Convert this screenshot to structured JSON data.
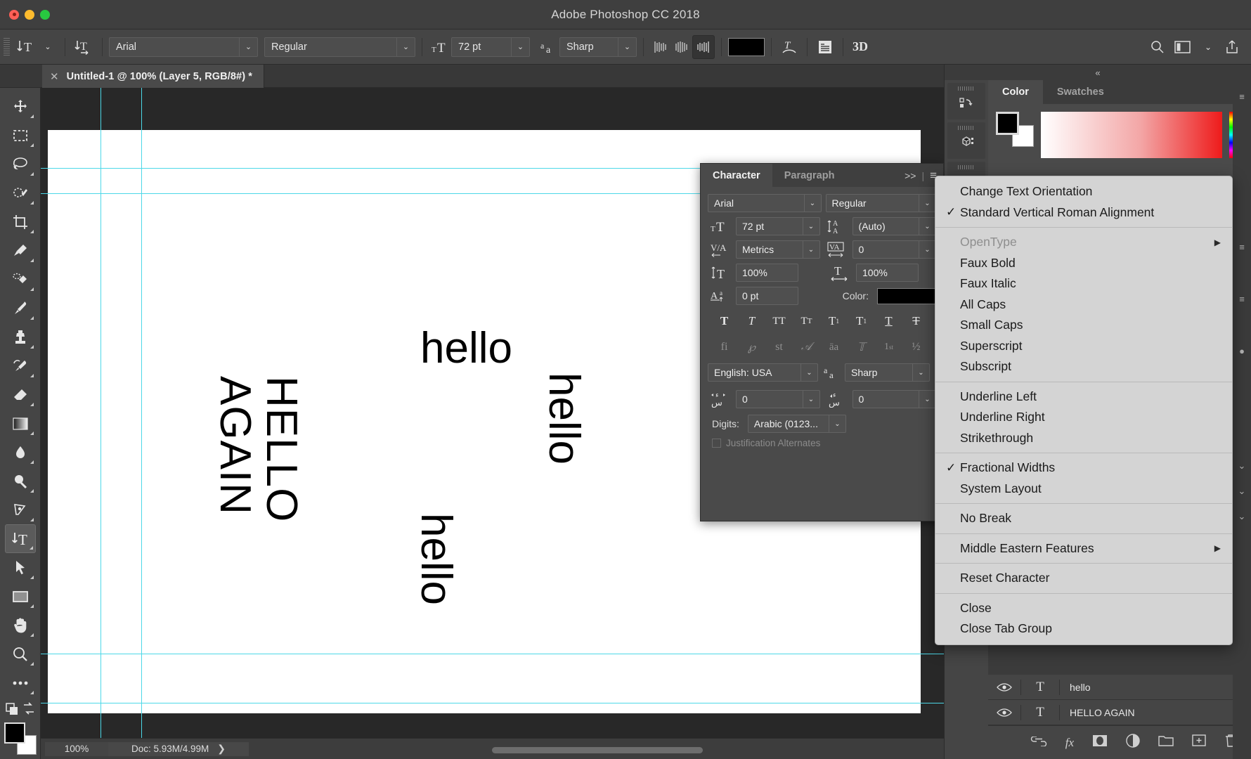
{
  "window": {
    "title": "Adobe Photoshop CC 2018"
  },
  "options_bar": {
    "tool_preset_icon": "vertical-type-tool-icon",
    "orientation_icon": "toggle-text-orientation-icon",
    "font_family": "Arial",
    "font_style": "Regular",
    "font_size": "72 pt",
    "antialias_icon": "anti-aliasing-icon",
    "antialias": "Sharp",
    "align_left_icon": "align-text-left-icon",
    "align_center_icon": "align-text-center-icon",
    "align_right_icon": "align-text-right-icon",
    "color_label": "text-color-swatch",
    "color_hex": "#000000",
    "warp_icon": "create-warped-text-icon",
    "panels_icon": "toggle-character-paragraph-panels-icon",
    "three_d_icon": "3D",
    "search_icon": "search-icon",
    "workspace_icon": "workspace-switcher-icon",
    "share_icon": "share-icon"
  },
  "document": {
    "tab_title": "Untitled-1 @ 100% (Layer 5, RGB/8#) *",
    "close_icon": "close-tab-icon"
  },
  "toolbar": {
    "tools": [
      {
        "name": "move-tool",
        "active": false
      },
      {
        "name": "rectangular-marquee-tool",
        "active": false
      },
      {
        "name": "lasso-tool",
        "active": false
      },
      {
        "name": "quick-selection-tool",
        "active": false
      },
      {
        "name": "crop-tool",
        "active": false
      },
      {
        "name": "eyedropper-tool",
        "active": false
      },
      {
        "name": "spot-healing-brush-tool",
        "active": false
      },
      {
        "name": "brush-tool",
        "active": false
      },
      {
        "name": "clone-stamp-tool",
        "active": false
      },
      {
        "name": "history-brush-tool",
        "active": false
      },
      {
        "name": "eraser-tool",
        "active": false
      },
      {
        "name": "gradient-tool",
        "active": false
      },
      {
        "name": "blur-tool",
        "active": false
      },
      {
        "name": "dodge-tool",
        "active": false
      },
      {
        "name": "pen-tool",
        "active": false
      },
      {
        "name": "vertical-type-tool",
        "active": true
      },
      {
        "name": "path-selection-tool",
        "active": false
      },
      {
        "name": "rectangle-tool",
        "active": false
      },
      {
        "name": "hand-tool",
        "active": false
      },
      {
        "name": "zoom-tool",
        "active": false
      },
      {
        "name": "edit-toolbar-tool",
        "active": false
      }
    ],
    "foreground_color": "#000000",
    "background_color": "#ffffff"
  },
  "canvas": {
    "texts": [
      {
        "content": "hello",
        "orientation": "horizontal"
      },
      {
        "content": "HELLO",
        "orientation": "vertical"
      },
      {
        "content": "AGAIN",
        "orientation": "vertical"
      },
      {
        "content": "hello",
        "orientation": "vertical"
      },
      {
        "content": "hello",
        "orientation": "vertical"
      }
    ],
    "guide_color": "#4cd8e8"
  },
  "status_bar": {
    "zoom": "100%",
    "doc_info": "Doc: 5.93M/4.99M",
    "expand_icon": "status-expand-icon"
  },
  "character_panel": {
    "tabs": [
      {
        "label": "Character",
        "active": true
      },
      {
        "label": "Paragraph",
        "active": false
      }
    ],
    "expand_icon": ">>",
    "menu_icon": "panel-menu-icon",
    "font_family": "Arial",
    "font_style": "Regular",
    "size_icon": "font-size-icon",
    "size_value": "72 pt",
    "leading_icon": "leading-icon",
    "leading_value": "(Auto)",
    "kerning_icon": "kerning-icon",
    "kerning_value": "Metrics",
    "tracking_icon": "tracking-icon",
    "tracking_value": "0",
    "vscale_icon": "vertical-scale-icon",
    "vscale_value": "100%",
    "hscale_icon": "horizontal-scale-icon",
    "hscale_value": "100%",
    "baseline_icon": "baseline-shift-icon",
    "baseline_value": "0 pt",
    "color_label": "Color:",
    "color_hex": "#000000",
    "style_glyphs": [
      "T",
      "T",
      "TT",
      "Tт",
      "T¹",
      "T₁",
      "T",
      "T"
    ],
    "opentype_glyphs": [
      "fi",
      "℘",
      "st",
      "𝒜",
      "aͣa",
      "𝕋",
      "1st",
      "½"
    ],
    "language": "English: USA",
    "aa_icon": "anti-aliasing-icon",
    "antialias": "Sharp",
    "tatweel_icon": "kashida-icon",
    "tatweel_value": "0",
    "tashkeel_icon": "diacritics-icon",
    "tashkeel_value": "0",
    "digits_label": "Digits:",
    "digits_value": "Arabic (0123...",
    "justification_alternates": "Justification Alternates"
  },
  "context_menu": {
    "items": [
      {
        "label": "Change Text Orientation",
        "checked": false,
        "disabled": false,
        "submenu": false
      },
      {
        "label": "Standard Vertical Roman Alignment",
        "checked": true,
        "disabled": false,
        "submenu": false
      },
      {
        "separator": true
      },
      {
        "label": "OpenType",
        "checked": false,
        "disabled": true,
        "submenu": true
      },
      {
        "label": "Faux Bold",
        "checked": false,
        "disabled": false,
        "submenu": false
      },
      {
        "label": "Faux Italic",
        "checked": false,
        "disabled": false,
        "submenu": false
      },
      {
        "label": "All Caps",
        "checked": false,
        "disabled": false,
        "submenu": false
      },
      {
        "label": "Small Caps",
        "checked": false,
        "disabled": false,
        "submenu": false
      },
      {
        "label": "Superscript",
        "checked": false,
        "disabled": false,
        "submenu": false
      },
      {
        "label": "Subscript",
        "checked": false,
        "disabled": false,
        "submenu": false
      },
      {
        "separator": true
      },
      {
        "label": "Underline Left",
        "checked": false,
        "disabled": false,
        "submenu": false
      },
      {
        "label": "Underline Right",
        "checked": false,
        "disabled": false,
        "submenu": false
      },
      {
        "label": "Strikethrough",
        "checked": false,
        "disabled": false,
        "submenu": false
      },
      {
        "separator": true
      },
      {
        "label": "Fractional Widths",
        "checked": true,
        "disabled": false,
        "submenu": false
      },
      {
        "label": "System Layout",
        "checked": false,
        "disabled": false,
        "submenu": false
      },
      {
        "separator": true
      },
      {
        "label": "No Break",
        "checked": false,
        "disabled": false,
        "submenu": false
      },
      {
        "separator": true
      },
      {
        "label": "Middle Eastern Features",
        "checked": false,
        "disabled": false,
        "submenu": true
      },
      {
        "separator": true
      },
      {
        "label": "Reset Character",
        "checked": false,
        "disabled": false,
        "submenu": false
      },
      {
        "separator": true
      },
      {
        "label": "Close",
        "checked": false,
        "disabled": false,
        "submenu": false
      },
      {
        "label": "Close Tab Group",
        "checked": false,
        "disabled": false,
        "submenu": false
      }
    ]
  },
  "right_dock": {
    "collapse_icon": "«",
    "strip_buttons": [
      "history-panel-icon",
      "3d-panel-icon",
      "properties-panel-icon"
    ],
    "panel_tabs": [
      {
        "label": "Color",
        "active": true
      },
      {
        "label": "Swatches",
        "active": false
      }
    ],
    "menu_icon": "panel-menu-icon",
    "foreground_color": "#000000",
    "background_color": "#ffffff",
    "layers": [
      {
        "name": "hello",
        "type_icon": "T",
        "visible": true
      },
      {
        "name": "HELLO  AGAIN",
        "type_icon": "T",
        "visible": true
      }
    ],
    "footer_icons": [
      "link-layers-icon",
      "fx-icon",
      "layer-mask-icon",
      "adjustment-layer-icon",
      "new-folder-icon",
      "new-layer-icon",
      "delete-layer-icon"
    ]
  }
}
